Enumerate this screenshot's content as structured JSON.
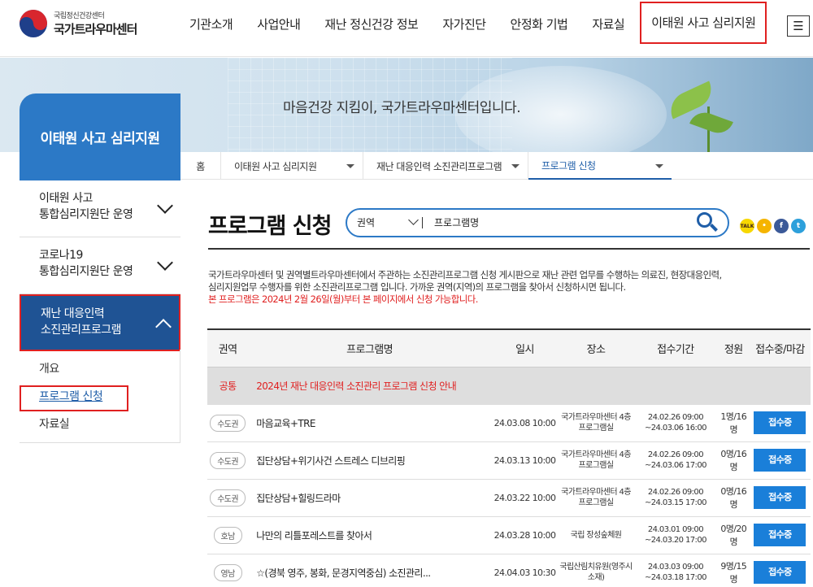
{
  "header": {
    "logo_small": "국립정신건강센터",
    "logo_big": "국가트라우마센터",
    "nav": [
      "기관소개",
      "사업안내",
      "재난 정신건강 정보",
      "자가진단",
      "안정화 기법",
      "자료실",
      "이태원 사고 심리지원"
    ],
    "menu_glyph": "☰"
  },
  "banner": {
    "slogan": "마음건강 지킴이, 국가트라우마센터입니다."
  },
  "sidebar": {
    "title": "이태원 사고 심리지원",
    "items": [
      {
        "line1": "이태원 사고",
        "line2": "통합심리지원단 운영"
      },
      {
        "line1": "코로나19",
        "line2": "통합심리지원단 운영"
      },
      {
        "line1": "재난 대응인력",
        "line2": "소진관리프로그램"
      }
    ],
    "sub_items": [
      "개요",
      "프로그램 신청",
      "자료실"
    ]
  },
  "breadcrumb": {
    "home": "홈",
    "level1": "이태원 사고 심리지원",
    "level2": "재난 대응인력 소진관리프로그램",
    "level3": "프로그램 신청"
  },
  "main": {
    "title": "프로그램 신청",
    "search": {
      "select_label": "권역",
      "input_value": "프로그램명"
    },
    "share": {
      "kakaotalk": "TALK",
      "kakaostory": "•",
      "facebook": "f",
      "twitter": "t"
    },
    "desc_line1": "국가트라우마센터 및 권역별트라우마센터에서 주관하는 소진관리프로그램 신청 게시판으로 재난 관련 업무를 수행하는 의료진, 현장대응인력,",
    "desc_line2": "심리지원업무 수행자를 위한 소진관리프로그램 입니다. 가까운 권역(지역)의 프로그램을 찾아서 신청하시면 됩니다.",
    "desc_note": "본 프로그램은 2024년 2월 26일(월)부터 본 페이지에서 신청 가능합니다."
  },
  "table": {
    "headers": [
      "권역",
      "프로그램명",
      "일시",
      "장소",
      "접수기간",
      "정원",
      "접수중/마감"
    ],
    "notice": {
      "region": "공통",
      "program": "2024년 재난 대응인력 소진관리 프로그램 신청 안내"
    },
    "rows": [
      {
        "region": "수도권",
        "program": "마음교육+TRE",
        "date": "24.03.08 10:00",
        "place1": "국가트라우마센터 4층",
        "place2": "프로그램실",
        "period1": "24.02.26 09:00",
        "period2": "~24.03.06 16:00",
        "capacity": "1명/16명",
        "status": "접수중"
      },
      {
        "region": "수도권",
        "program": "집단상담+위기사건 스트레스 디브리핑",
        "date": "24.03.13 10:00",
        "place1": "국가트라우마센터 4층",
        "place2": "프로그램실",
        "period1": "24.02.26 09:00",
        "period2": "~24.03.06 17:00",
        "capacity": "0명/16명",
        "status": "접수중"
      },
      {
        "region": "수도권",
        "program": "집단상담+힐링드라마",
        "date": "24.03.22 10:00",
        "place1": "국가트라우마센터 4층",
        "place2": "프로그램실",
        "period1": "24.02.26 09:00",
        "period2": "~24.03.15 17:00",
        "capacity": "0명/16명",
        "status": "접수중"
      },
      {
        "region": "호남",
        "program": "나만의 리틀포레스트를 찾아서",
        "date": "24.03.28 10:00",
        "place1": "국립 장성숲체원",
        "place2": "",
        "period1": "24.03.01 09:00",
        "period2": "~24.03.20 17:00",
        "capacity": "0명/20명",
        "status": "접수중"
      },
      {
        "region": "영남",
        "program": "☆(경북 영주, 봉화, 문경지역중심) 소진관리...",
        "date": "24.04.03 10:30",
        "place1": "국립산림치유원(영주시",
        "place2": "소재)",
        "period1": "24.03.03 09:00",
        "period2": "~24.03.18 17:00",
        "capacity": "9명/15명",
        "status": "접수중"
      }
    ]
  }
}
